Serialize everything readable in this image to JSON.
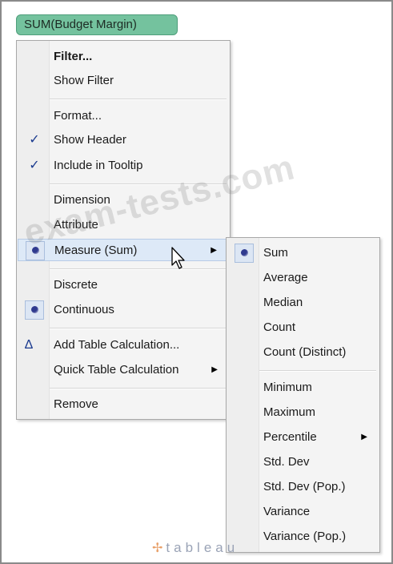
{
  "pill": {
    "label": "SUM(Budget Margin)",
    "color": "#74c29e"
  },
  "context_menu": {
    "items": [
      {
        "label": "Filter..."
      },
      {
        "label": "Show Filter"
      },
      {
        "label": "Format..."
      },
      {
        "label": "Show Header",
        "checked": true,
        "mark": "✓"
      },
      {
        "label": "Include in Tooltip",
        "checked": true,
        "mark": "✓"
      },
      {
        "label": "Dimension"
      },
      {
        "label": "Attribute"
      },
      {
        "label": "Measure (Sum)",
        "selected": true,
        "submenu": true,
        "arrow": "▶"
      },
      {
        "label": "Discrete"
      },
      {
        "label": "Continuous",
        "selected": true
      },
      {
        "label": "Add Table Calculation...",
        "mark": "Δ"
      },
      {
        "label": "Quick Table Calculation",
        "submenu": true,
        "arrow": "▶"
      },
      {
        "label": "Remove"
      }
    ]
  },
  "measure_submenu": {
    "items": [
      {
        "label": "Sum",
        "selected": true
      },
      {
        "label": "Average"
      },
      {
        "label": "Median"
      },
      {
        "label": "Count"
      },
      {
        "label": "Count (Distinct)"
      },
      {
        "label": "Minimum"
      },
      {
        "label": "Maximum"
      },
      {
        "label": "Percentile",
        "submenu": true,
        "arrow": "▶"
      },
      {
        "label": "Std. Dev"
      },
      {
        "label": "Std. Dev (Pop.)"
      },
      {
        "label": "Variance"
      },
      {
        "label": "Variance (Pop.)"
      }
    ]
  },
  "watermark": "exam-tests.com",
  "logo": {
    "mark": "✢",
    "text": "tableau"
  },
  "icons": {
    "check": "checkmark-icon",
    "radio": "radio-dot-icon",
    "delta": "delta-icon",
    "submenu": "submenu-arrow-icon",
    "cursor": "mouse-pointer-icon"
  },
  "colors": {
    "menu_bg": "#f4f4f4",
    "hover": "#dde9f7",
    "radio_dot": "#2f3a8f"
  }
}
